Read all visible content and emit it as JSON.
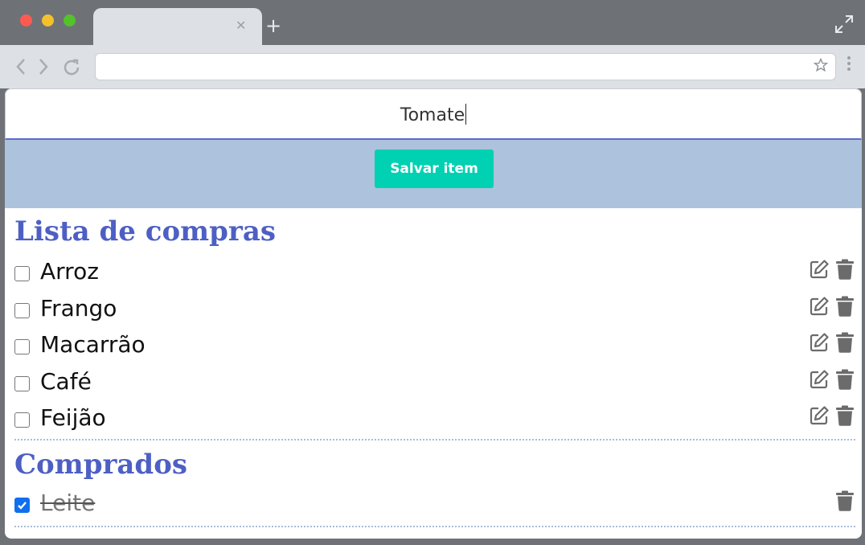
{
  "input": {
    "value": "Tomate"
  },
  "save_button": {
    "label": "Salvar item"
  },
  "shopping_list": {
    "title": "Lista de compras",
    "items": [
      {
        "label": "Arroz",
        "checked": false
      },
      {
        "label": "Frango",
        "checked": false
      },
      {
        "label": "Macarrão",
        "checked": false
      },
      {
        "label": "Café",
        "checked": false
      },
      {
        "label": "Feijão",
        "checked": false
      }
    ]
  },
  "purchased": {
    "title": "Comprados",
    "items": [
      {
        "label": "Leite",
        "checked": true
      }
    ]
  },
  "colors": {
    "accent": "#00d1b2",
    "title": "#4e5fc4",
    "band": "#adc2dc",
    "checkbox_checked": "#0f6ff0"
  }
}
